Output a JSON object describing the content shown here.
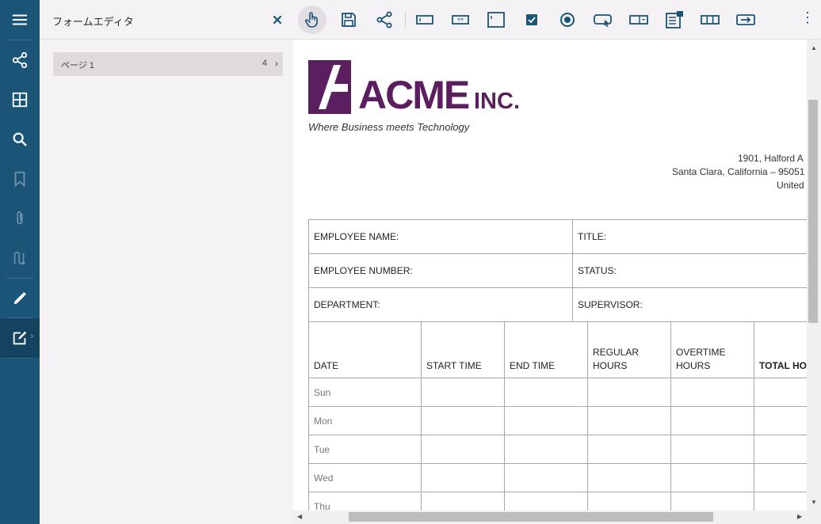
{
  "panel": {
    "title": "フォームエディタ",
    "page_item": {
      "label": "ページ 1",
      "count": "4",
      "chevron": "›"
    }
  },
  "rail": {
    "items": [
      {
        "name": "menu-icon"
      },
      {
        "name": "share-icon"
      },
      {
        "name": "thumbnails-icon"
      },
      {
        "name": "search-icon"
      },
      {
        "name": "bookmark-icon"
      },
      {
        "name": "attachment-icon"
      },
      {
        "name": "signature-icon"
      },
      {
        "name": "pencil-icon"
      },
      {
        "name": "form-editor-icon"
      }
    ],
    "active_arrow": "›"
  },
  "toolbar": {
    "more": "⋮",
    "tools": [
      "pointer-icon",
      "save-icon",
      "share-icon",
      "textbox-icon",
      "password-icon",
      "textarea-icon",
      "checkbox-icon",
      "radio-icon",
      "button-icon",
      "dropdown-icon",
      "listbox-icon",
      "comb-icon",
      "signature-field-icon"
    ]
  },
  "doc": {
    "tagline": "Where Business meets Technology",
    "address": [
      "1901, Halford A",
      "Santa Clara, California – 95051",
      "United"
    ],
    "employee_table": [
      [
        "EMPLOYEE NAME:",
        "TITLE:"
      ],
      [
        "EMPLOYEE NUMBER:",
        "STATUS:"
      ],
      [
        "DEPARTMENT:",
        "SUPERVISOR:"
      ]
    ],
    "timesheet_headers": [
      "DATE",
      "START TIME",
      "END TIME",
      "REGULAR\nHOURS",
      "OVERTIME\nHOURS",
      "TOTAL HO"
    ],
    "days": [
      "Sun",
      "Mon",
      "Tue",
      "Wed",
      "Thu"
    ]
  },
  "colors": {
    "rail": "#1a5476",
    "accent": "#1a5476",
    "logo": "#5b1e5e"
  }
}
